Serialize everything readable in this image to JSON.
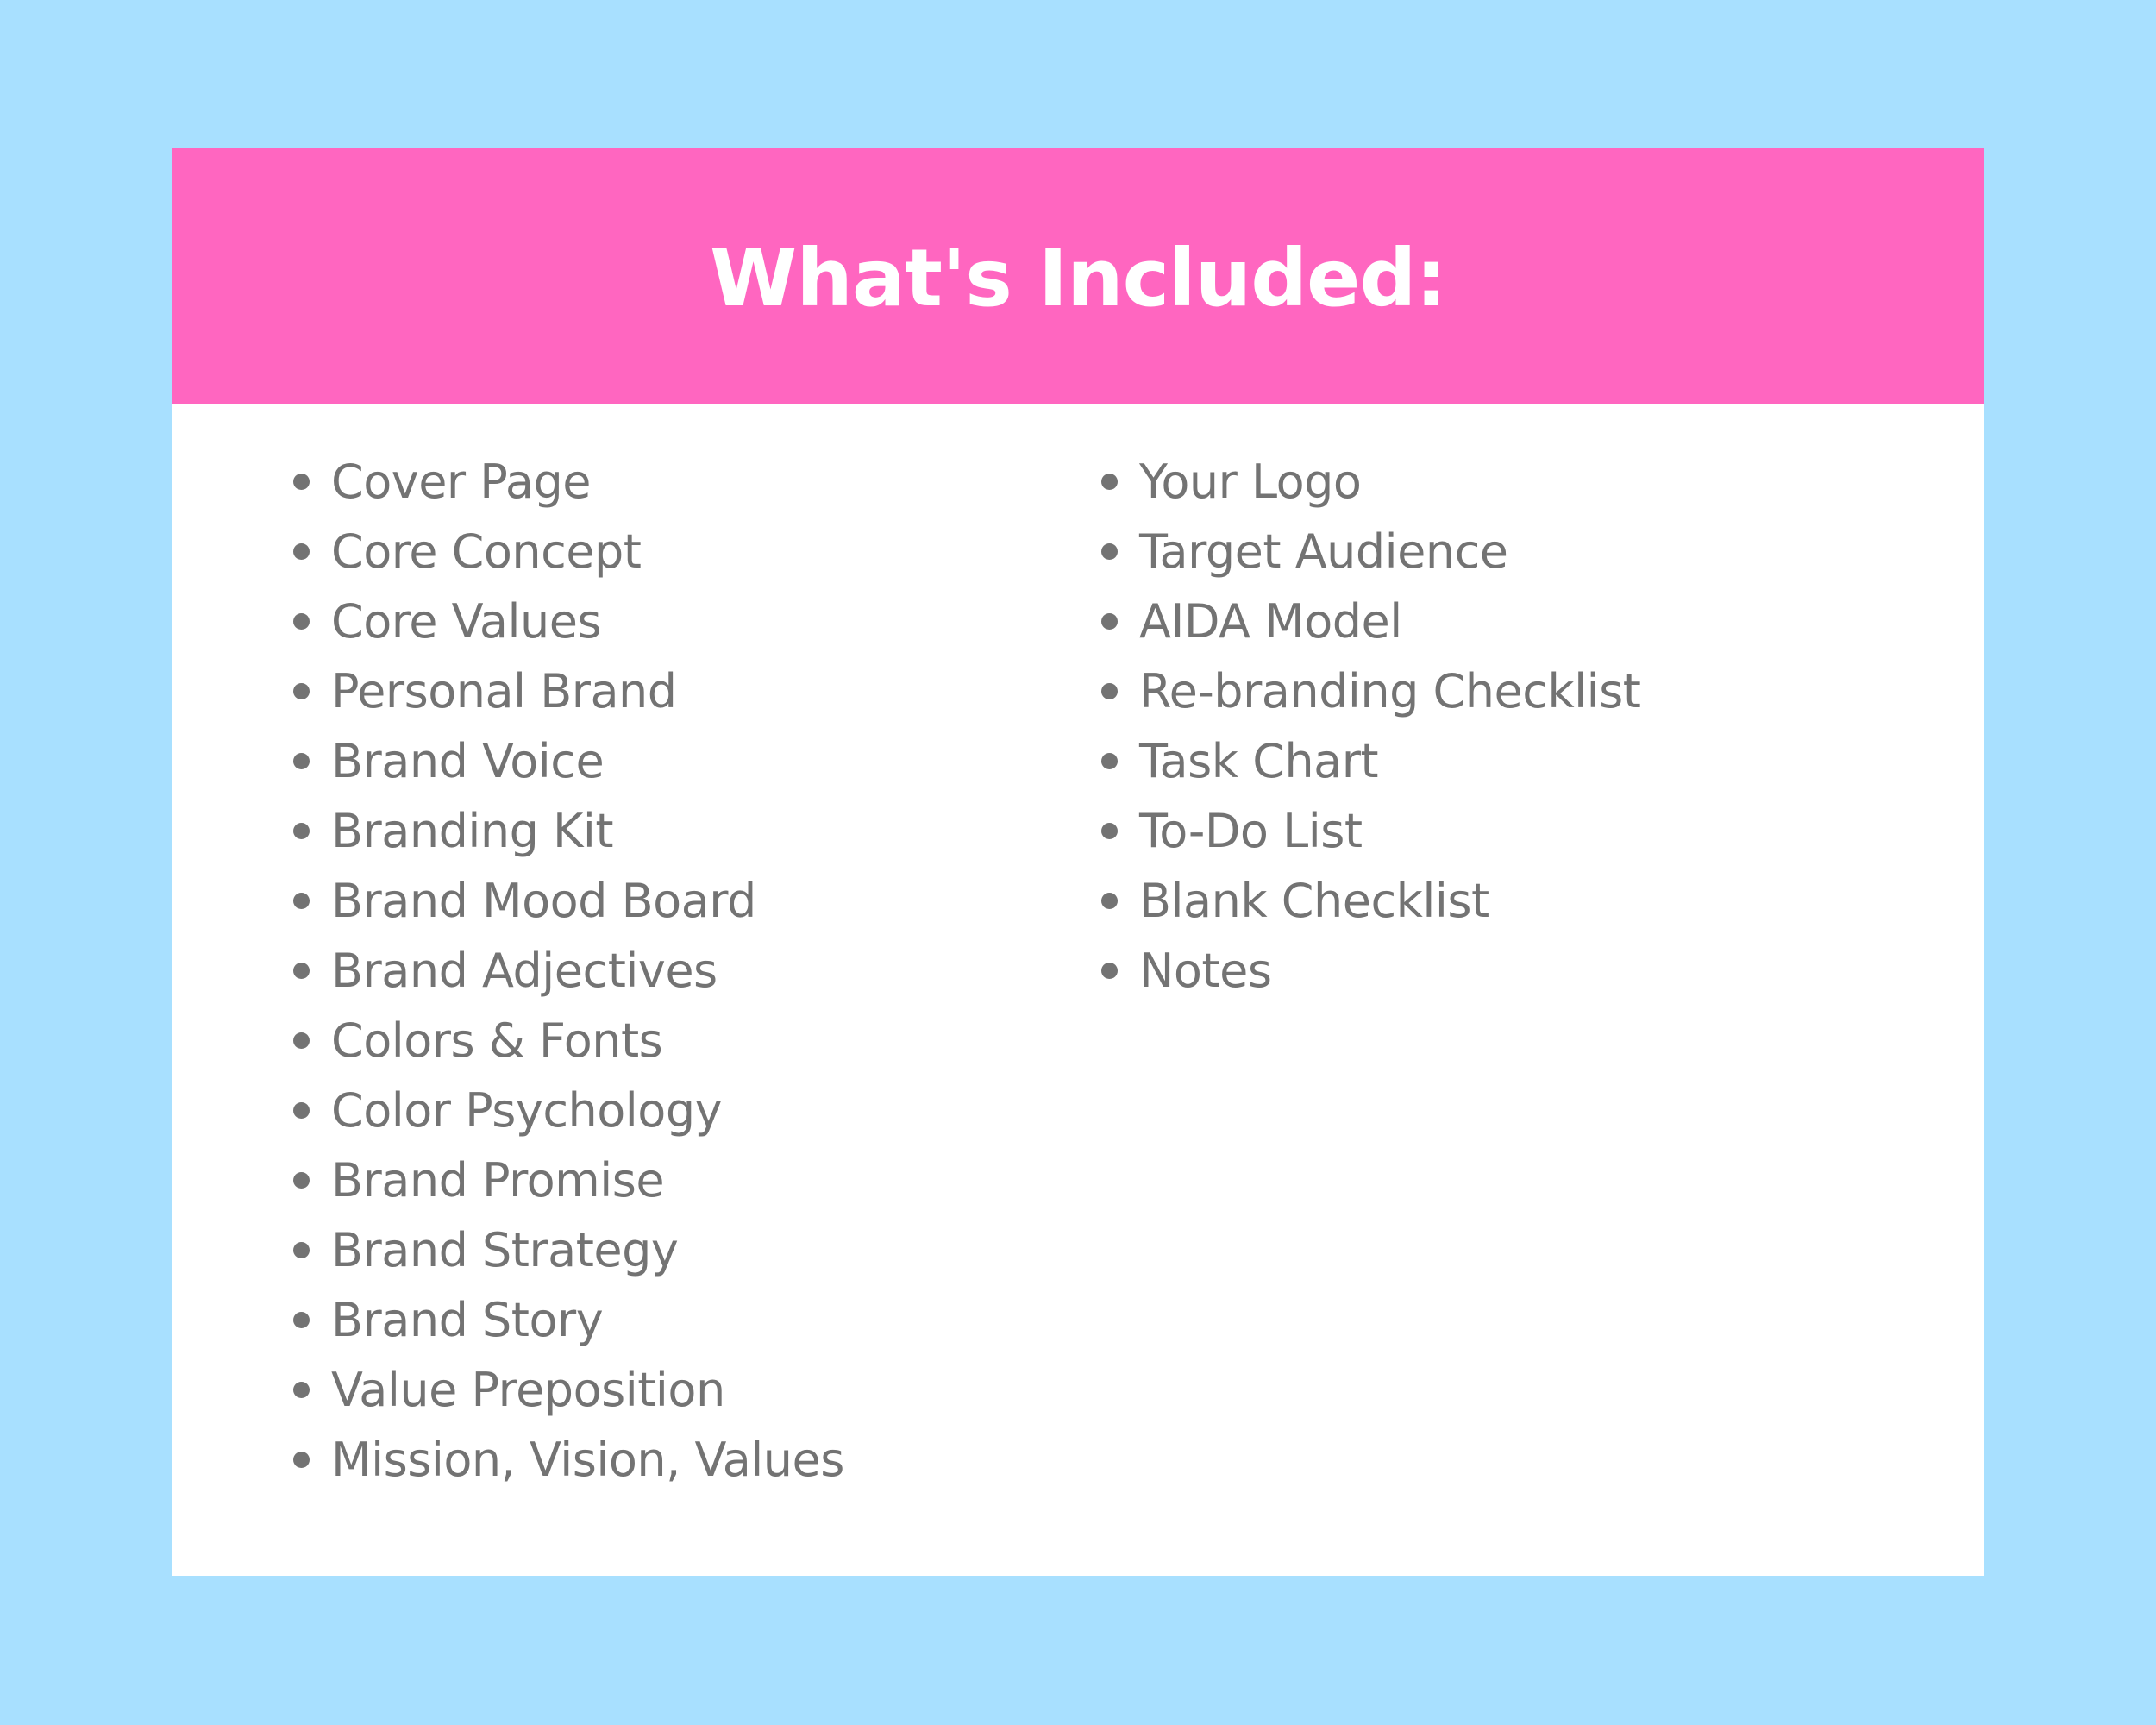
{
  "colors": {
    "background": "#a8e0ff",
    "header": "#ff66c0",
    "card": "#ffffff",
    "title_text": "#ffffff",
    "list_text": "#737373"
  },
  "header": {
    "title": "What's Included:"
  },
  "lists": {
    "left": [
      "Cover Page",
      "Core Concept",
      "Core Values",
      "Personal Brand",
      "Brand Voice",
      "Branding Kit",
      "Brand Mood Board",
      "Brand Adjectives",
      "Colors & Fonts",
      "Color Psychology",
      "Brand Promise",
      "Brand Strategy",
      "Brand Story",
      "Value Preposition",
      "Mission, Vision, Values"
    ],
    "right": [
      "Your Logo",
      "Target Audience",
      "AIDA Model",
      "Re-branding Checklist",
      "Task Chart",
      "To-Do List",
      "Blank Checklist",
      "Notes"
    ]
  }
}
